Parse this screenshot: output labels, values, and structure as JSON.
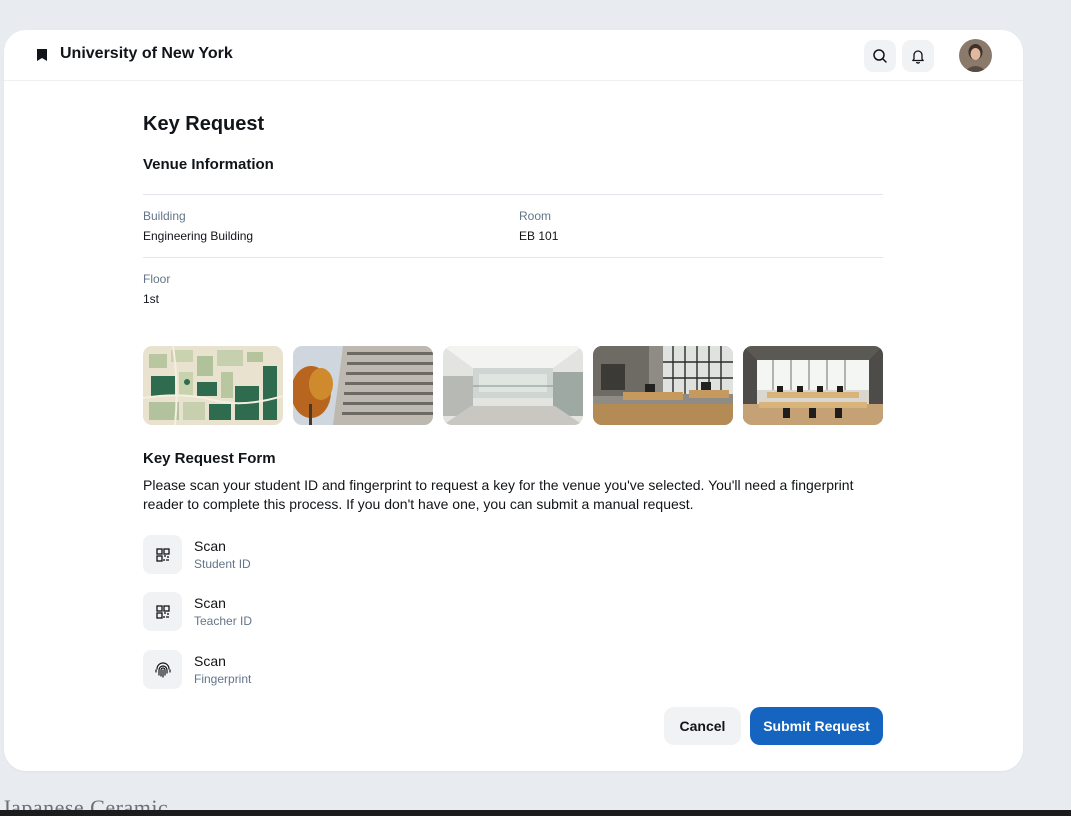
{
  "header": {
    "brand_name": "University of New York",
    "icons": [
      "flag-icon",
      "search-icon",
      "bell-icon",
      "avatar"
    ]
  },
  "page": {
    "title": "Key Request",
    "venue_section_title": "Venue Information"
  },
  "venue": {
    "building_label": "Building",
    "building_value": "Engineering Building",
    "room_label": "Room",
    "room_value": "EB 101",
    "floor_label": "Floor",
    "floor_value": "1st"
  },
  "gallery": [
    "campus-map",
    "building-exterior",
    "atrium-interior",
    "office-room",
    "open-workspace"
  ],
  "form": {
    "title": "Key Request Form",
    "description": "Please scan your student ID and fingerprint to request a key for the venue you've selected. You'll need a fingerprint reader to complete this process. If you don't have one, you can submit a manual request.",
    "scan_items": [
      {
        "title": "Scan",
        "subtitle": "Student ID",
        "icon": "qr-code-icon"
      },
      {
        "title": "Scan",
        "subtitle": "Teacher ID",
        "icon": "qr-code-icon"
      },
      {
        "title": "Scan",
        "subtitle": "Fingerprint",
        "icon": "fingerprint-icon"
      }
    ]
  },
  "actions": {
    "cancel_label": "Cancel",
    "submit_label": "Submit Request"
  },
  "background": {
    "partial_text": "Japanese Ceramic"
  },
  "colors": {
    "primary": "#1565c0",
    "muted_text": "#637588",
    "surface": "#f0f2f4"
  }
}
